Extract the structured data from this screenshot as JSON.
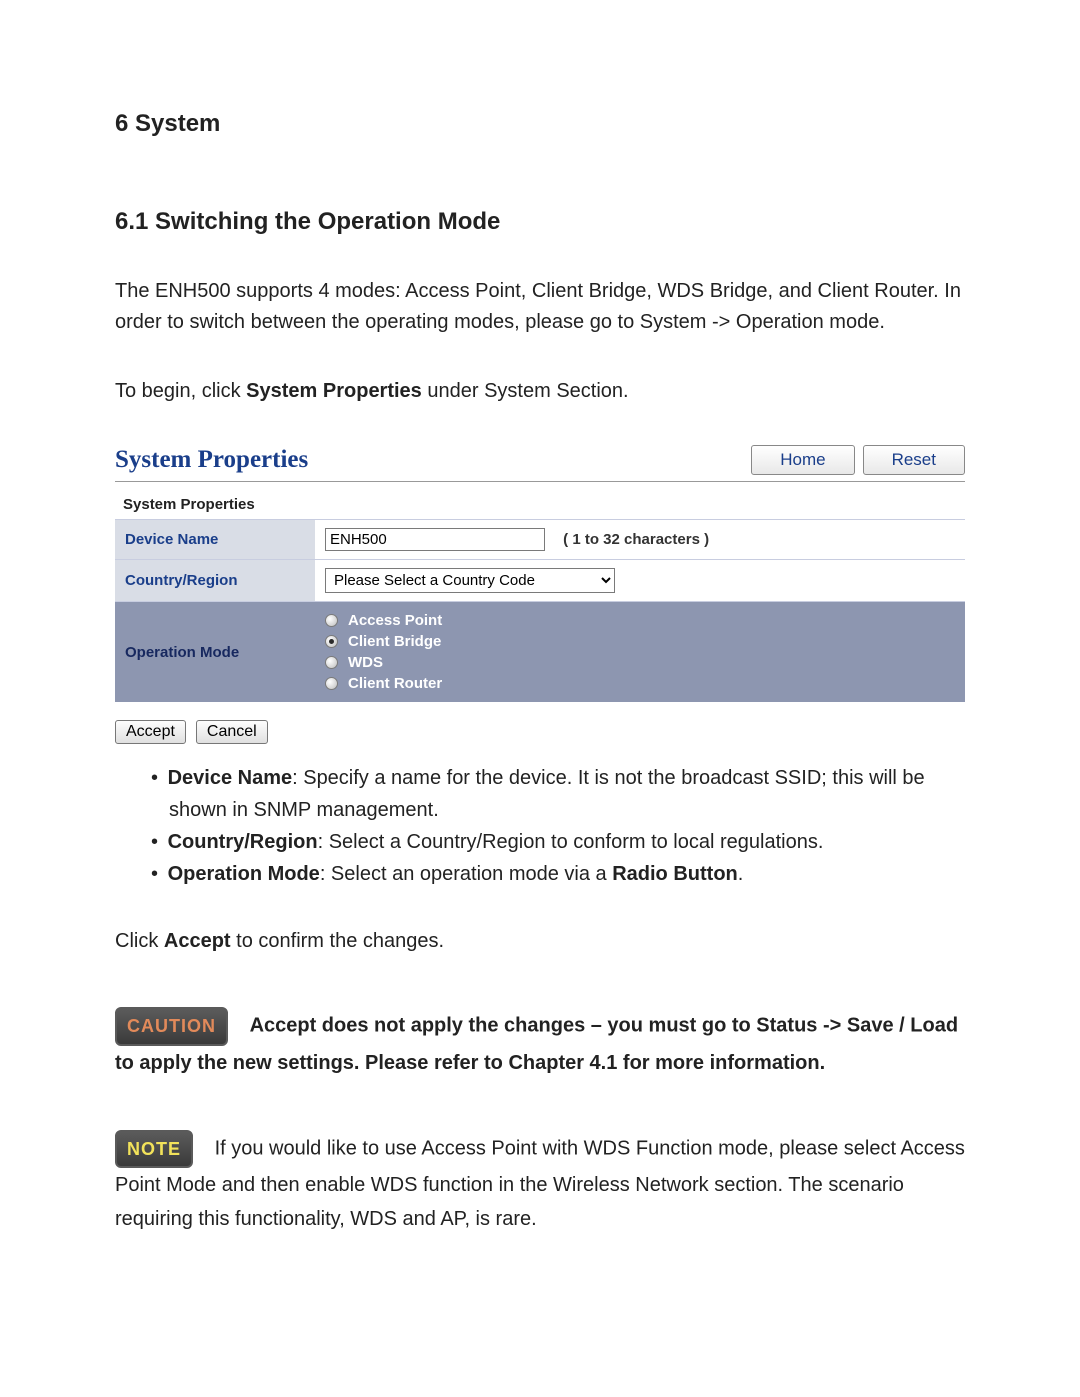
{
  "chapter": "6 System",
  "section": "6.1 Switching the Operation Mode",
  "intro_para": "The ENH500 supports 4 modes: Access Point, Client Bridge, WDS Bridge, and Client Router. In order to switch between the operating modes, please go to System -> Operation mode.",
  "begin_para_pre": "To begin, click ",
  "begin_para_bold": "System Properties",
  "begin_para_post": " under System Section.",
  "figure": {
    "title": "System Properties",
    "home": "Home",
    "reset": "Reset",
    "subtitle": "System Properties",
    "device_name_label": "Device Name",
    "device_name_value": "ENH500",
    "device_name_hint": "( 1 to 32 characters )",
    "country_label": "Country/Region",
    "country_placeholder": "Please Select a Country Code",
    "opmode_label": "Operation Mode",
    "opmode_options": {
      "ap": "Access Point",
      "cb": "Client Bridge",
      "wds": "WDS",
      "cr": "Client Router"
    },
    "accept": "Accept",
    "cancel": "Cancel"
  },
  "bullets": {
    "b1_label": "Device Name",
    "b1_text": ": Specify a name for the device. It is not the broadcast SSID; this will be shown in SNMP management.",
    "b2_label": "Country/Region",
    "b2_text": ": Select a Country/Region to conform to local regulations.",
    "b3_label": "Operation Mode",
    "b3_text_pre": ": Select an operation mode via a ",
    "b3_text_bold": "Radio Button",
    "b3_text_post": "."
  },
  "confirm_pre": "Click ",
  "confirm_bold": "Accept",
  "confirm_post": " to confirm the changes.",
  "caution_label": "CAUTION",
  "caution_text": "Accept does not apply the changes – you must go to Status -> Save / Load to apply the new settings. Please refer to Chapter 4.1 for more information.",
  "note_label": "NOTE",
  "note_text": "If you would like to use Access Point with WDS Function mode, please select Access Point Mode and then enable WDS function in the Wireless Network section.   The scenario requiring this functionality, WDS and AP, is rare."
}
